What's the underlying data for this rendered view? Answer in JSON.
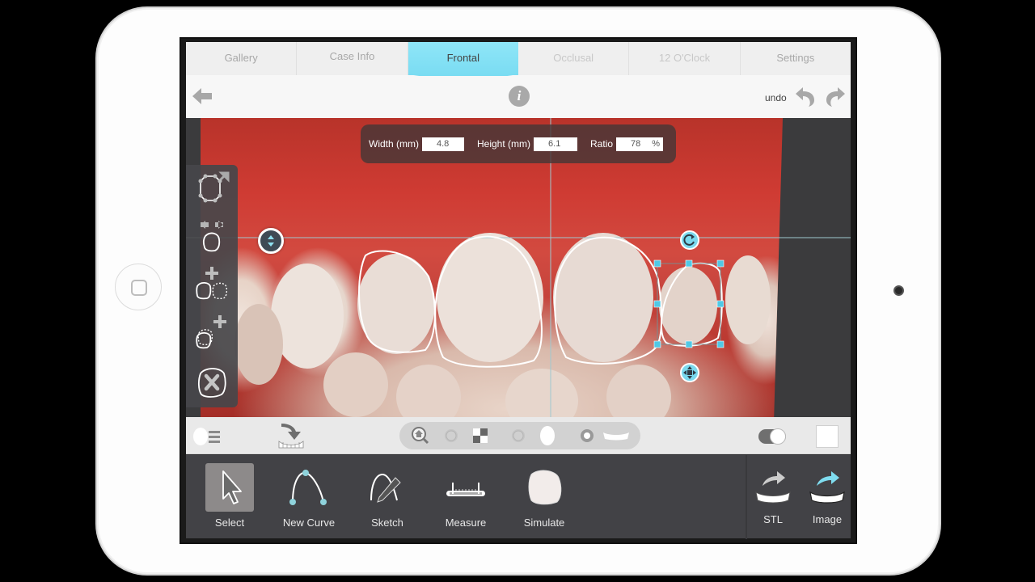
{
  "tabs": [
    {
      "label": "Gallery",
      "state": "normal"
    },
    {
      "label": "Case Info",
      "state": "normal"
    },
    {
      "label": "Frontal",
      "state": "active"
    },
    {
      "label": "Occlusal",
      "state": "disabled"
    },
    {
      "label": "12 O'Clock",
      "state": "disabled"
    },
    {
      "label": "Settings",
      "state": "normal"
    }
  ],
  "toolbar": {
    "back_icon": "back-arrow-icon",
    "info_label": "i",
    "undo_label": "undo",
    "undo_icon": "undo-icon",
    "redo_icon": "redo-icon"
  },
  "measurements": {
    "width_label": "Width (mm)",
    "width_value": "4.8",
    "height_label": "Height (mm)",
    "height_value": "6.1",
    "ratio_label": "Ratio",
    "ratio_value": "78",
    "ratio_unit": "%"
  },
  "side_tools": [
    {
      "name": "edit-points",
      "icon": "tooth-outline-points-icon"
    },
    {
      "name": "mirror-tooth",
      "icon": "mirror-tooth-icon"
    },
    {
      "name": "add-tooth-copy",
      "icon": "add-tooth-copy-icon"
    },
    {
      "name": "add-tooth-overlay",
      "icon": "add-tooth-overlay-icon"
    },
    {
      "name": "delete-tooth",
      "icon": "delete-tooth-icon"
    }
  ],
  "viewbar": {
    "left_icons": [
      "face-list-icon",
      "arch-load-icon"
    ],
    "view_modes": [
      "zoom-home-icon",
      "radio-off",
      "checker-icon",
      "radio-off",
      "face-icon",
      "radio-on",
      "smile-arch-icon"
    ],
    "toggle_on": true,
    "swatch_color": "#ffffff"
  },
  "tools": [
    {
      "label": "Select",
      "selected": true
    },
    {
      "label": "New Curve",
      "selected": false
    },
    {
      "label": "Sketch",
      "selected": false
    },
    {
      "label": "Measure",
      "selected": false
    },
    {
      "label": "Simulate",
      "selected": false
    }
  ],
  "exports": [
    {
      "label": "STL",
      "accent": "#cccccc"
    },
    {
      "label": "Image",
      "accent": "#7fdcef"
    }
  ],
  "colors": {
    "active_tab": "#7adcf2",
    "handle": "#4fc9e6",
    "guide_line": "#9fc8cf"
  }
}
